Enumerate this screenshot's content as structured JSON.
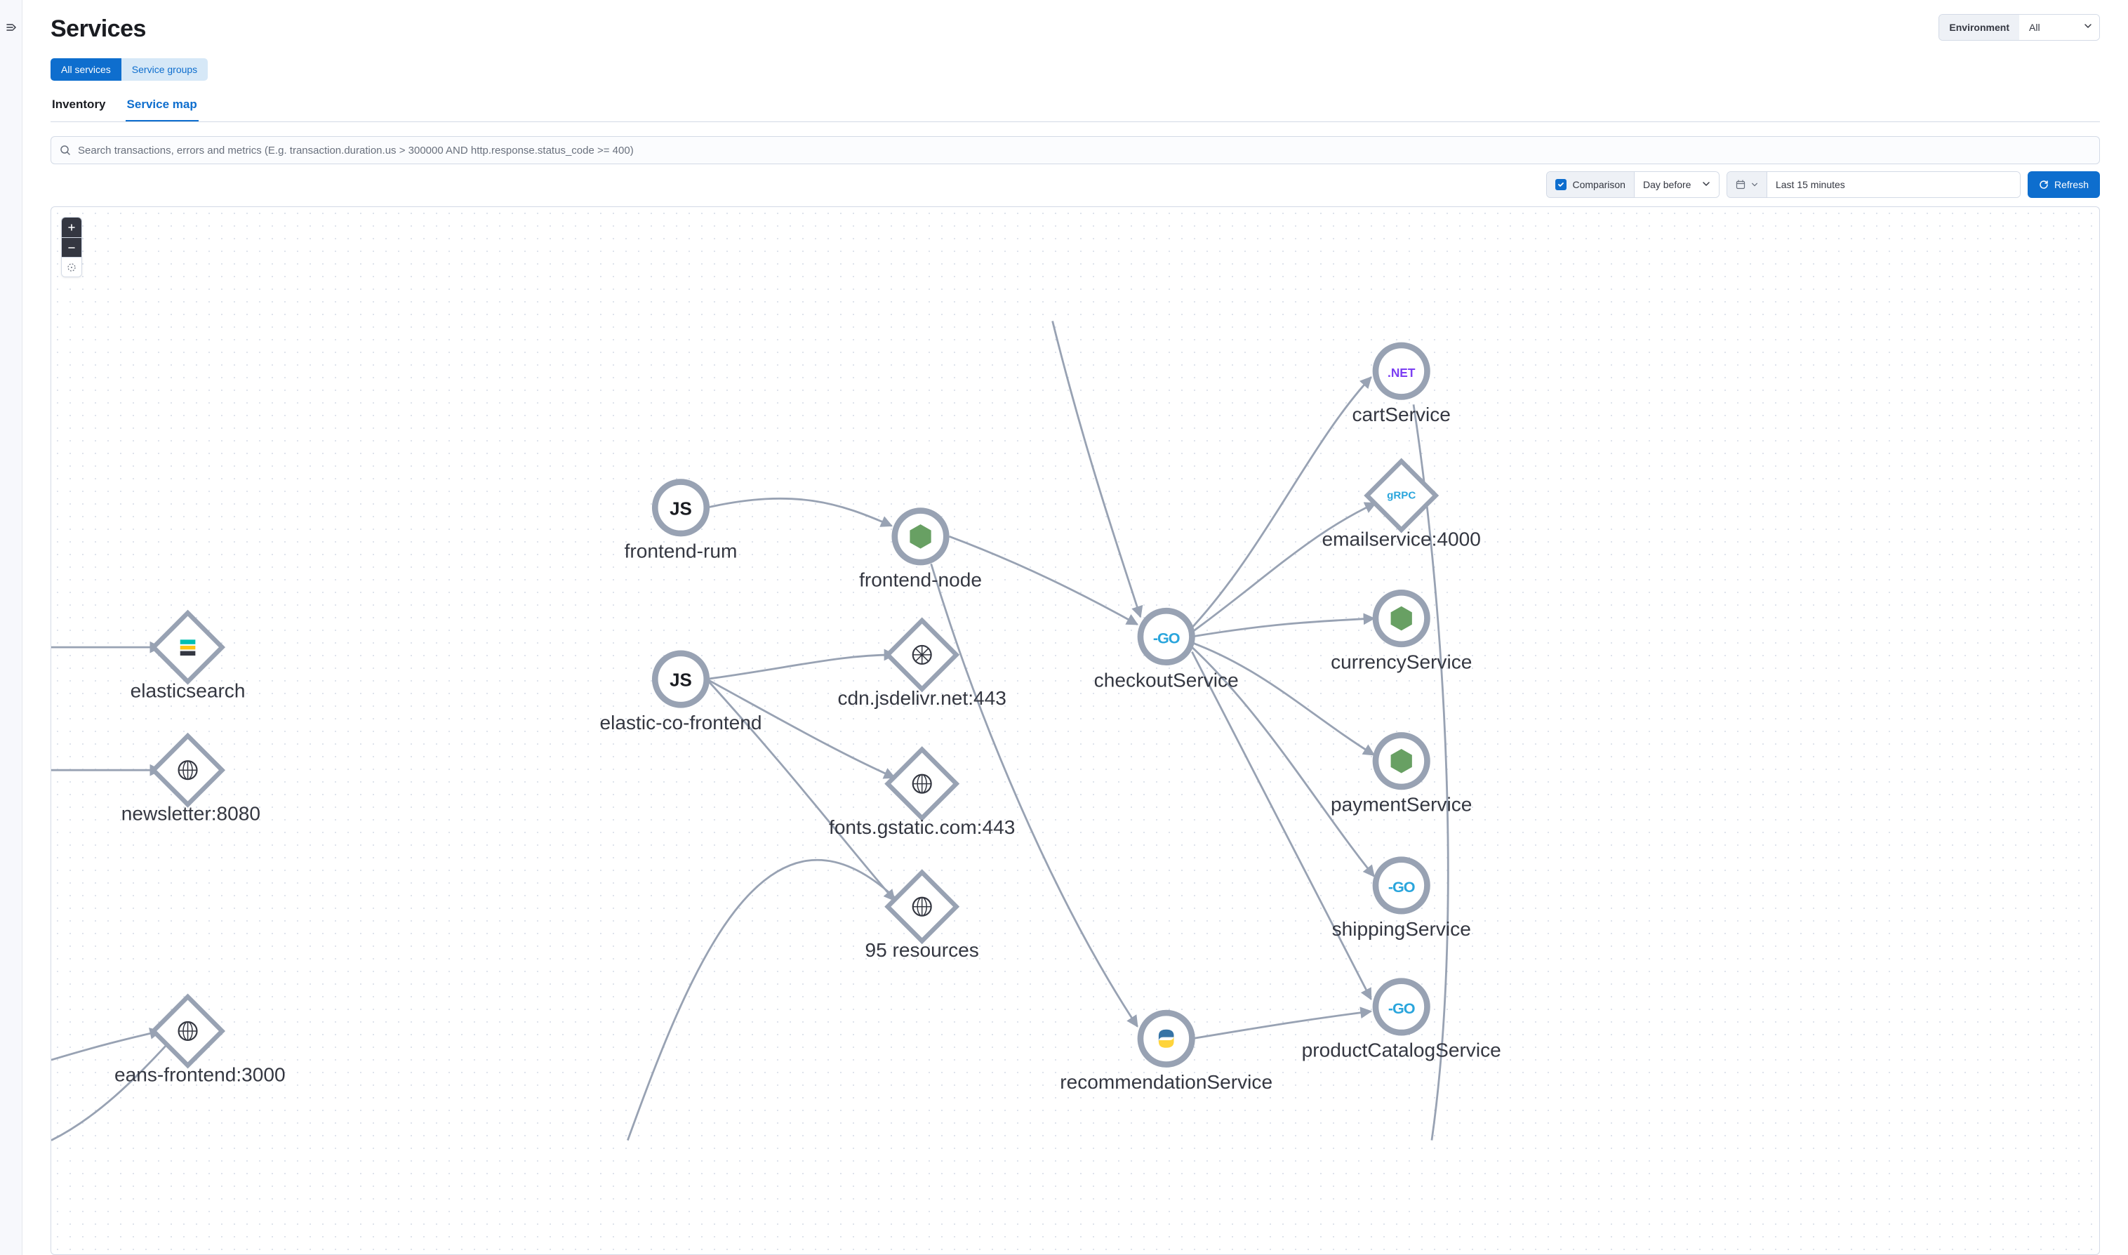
{
  "page": {
    "title": "Services"
  },
  "environment": {
    "label": "Environment",
    "value": "All"
  },
  "tab_group": {
    "all_services": "All services",
    "service_groups": "Service groups"
  },
  "sub_tabs": {
    "inventory": "Inventory",
    "service_map": "Service map"
  },
  "search": {
    "placeholder": "Search transactions, errors and metrics (E.g. transaction.duration.us > 300000 AND http.response.status_code >= 400)"
  },
  "comparison": {
    "label": "Comparison",
    "value": "Day before"
  },
  "time": {
    "value": "Last 15 minutes"
  },
  "refresh": {
    "label": "Refresh"
  },
  "map": {
    "nodes": {
      "frontend_rum": "frontend-rum",
      "frontend_node": "frontend-node",
      "elastic_co_frontend": "elastic-co-frontend",
      "elasticsearch": "elasticsearch",
      "newsletter": "newsletter:8080",
      "eans_frontend": "eans-frontend:3000",
      "cdn_jsdelivr": "cdn.jsdelivr.net:443",
      "fonts_gstatic": "fonts.gstatic.com:443",
      "resources": "95 resources",
      "checkout": "checkoutService",
      "recommendation": "recommendationService",
      "cart": "cartService",
      "emailservice": "emailservice:4000",
      "currency": "currencyService",
      "payment": "paymentService",
      "shipping": "shippingService",
      "product_catalog": "productCatalogService"
    }
  }
}
